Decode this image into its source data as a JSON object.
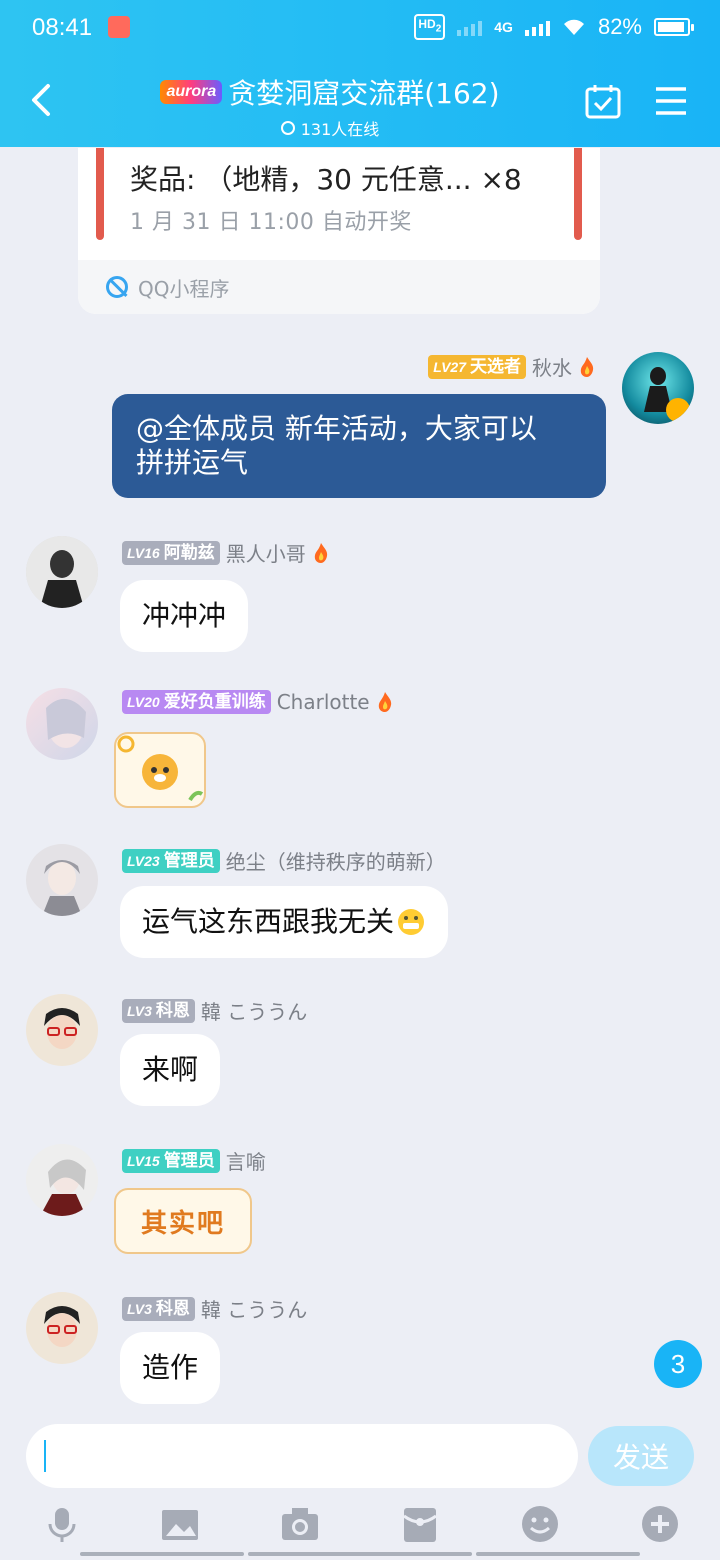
{
  "status_bar": {
    "time": "08:41",
    "network_hd": "HD",
    "network_hd_sub": "2",
    "network_type": "4G",
    "battery": "82%"
  },
  "header": {
    "brand": "aurora",
    "title": "贪婪洞窟交流群(162)",
    "online": "131人在线"
  },
  "mini_program": {
    "prize": "奖品: （地精，30 元任意...  ×8",
    "draw_time": "1 月 31 日 11:00 自动开奖",
    "source": "QQ小程序"
  },
  "messages": [
    {
      "lv": "LV27",
      "title": "天选者",
      "name": "秋水",
      "text": "@全体成员 新年活动，大家可以拼拼运气",
      "text_line1": "@全体成员 新年活动，大家可以",
      "text_line2": "拼拼运气",
      "badge_color": "#f5b731"
    },
    {
      "lv": "LV16",
      "title": "阿勒兹",
      "name": "黑人小哥",
      "text": "冲冲冲",
      "badge_color": "#a9adbb"
    },
    {
      "lv": "LV20",
      "title": "爱好负重训练",
      "name": "Charlotte",
      "badge_color": "#b889f2"
    },
    {
      "lv": "LV23",
      "title": "管理员",
      "name": "绝尘（维持秩序的萌新）",
      "text": "运气这东西跟我无关",
      "badge_color": "#3fd0c3"
    },
    {
      "lv": "LV3",
      "title": "科恩",
      "name": "韓 こううん",
      "text": "来啊",
      "badge_color": "#a9adbb"
    },
    {
      "lv": "LV15",
      "title": "管理员",
      "name": "言喻",
      "sticker_text": "其实吧",
      "badge_color": "#3fd0c3"
    },
    {
      "lv": "LV3",
      "title": "科恩",
      "name": "韓 こううん",
      "text": "造作",
      "badge_color": "#a9adbb"
    }
  ],
  "unread_count": "3",
  "input": {
    "placeholder": "",
    "send_label": "发送"
  },
  "toolbar": {
    "icons": [
      "microphone-icon",
      "image-icon",
      "camera-icon",
      "red-packet-icon",
      "emoji-icon",
      "plus-icon"
    ]
  },
  "colors": {
    "header": "#19b4f6",
    "background": "#eceef5",
    "own_bubble": "#2c5a96"
  }
}
